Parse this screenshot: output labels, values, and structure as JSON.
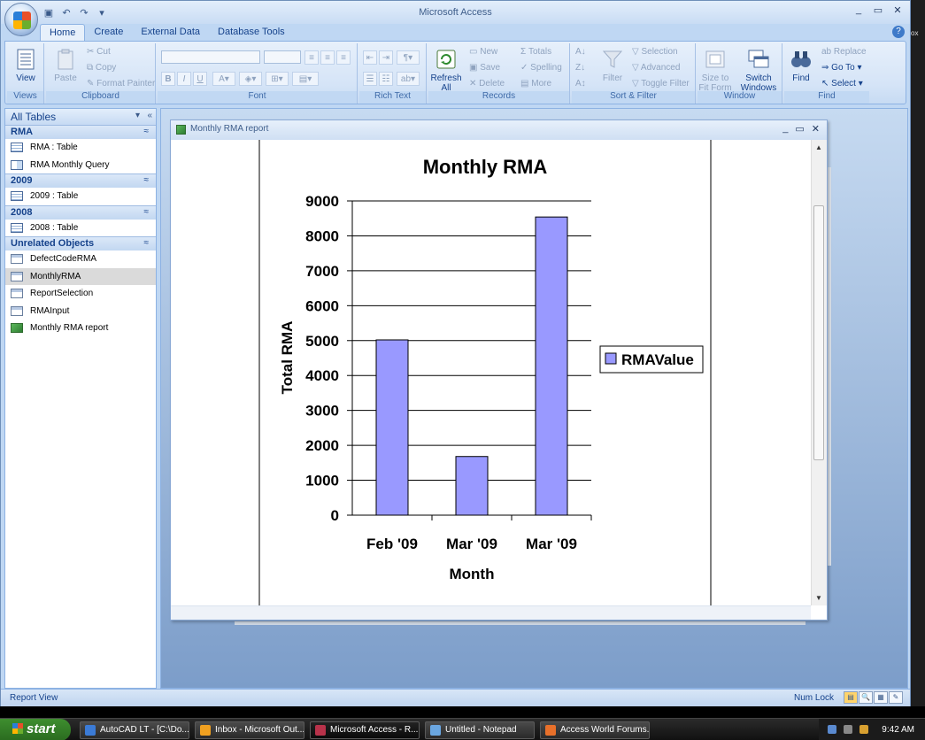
{
  "window": {
    "title": "Microsoft Access",
    "controls": [
      "_",
      "▭",
      "✕"
    ],
    "desktop_edge_text": "ox"
  },
  "quick_access": [
    "save",
    "undo",
    "redo",
    "customize"
  ],
  "tabs": [
    "Home",
    "Create",
    "External Data",
    "Database Tools"
  ],
  "ribbon": {
    "views": {
      "label": "Views",
      "view_btn": "View"
    },
    "clipboard": {
      "label": "Clipboard",
      "paste": "Paste",
      "cut": "Cut",
      "copy": "Copy",
      "format_painter": "Format Painter"
    },
    "font": {
      "label": "Font"
    },
    "rich_text": {
      "label": "Rich Text"
    },
    "records": {
      "label": "Records",
      "refresh": "Refresh All",
      "new": "New",
      "save": "Save",
      "delete": "Delete",
      "totals": "Totals",
      "spelling": "Spelling",
      "more": "More"
    },
    "sort_filter": {
      "label": "Sort & Filter",
      "filter": "Filter",
      "selection": "Selection",
      "advanced": "Advanced",
      "toggle_filter": "Toggle Filter"
    },
    "window": {
      "label": "Window",
      "size_to_fit": "Size to Fit Form",
      "switch_windows": "Switch Windows"
    },
    "find": {
      "label": "Find",
      "find": "Find",
      "replace": "Replace",
      "go_to": "Go To",
      "select": "Select"
    }
  },
  "nav": {
    "header": "All Tables",
    "sections": [
      {
        "title": "RMA",
        "items": [
          {
            "label": "RMA : Table",
            "icon": "table"
          },
          {
            "label": "RMA Monthly Query",
            "icon": "query"
          }
        ]
      },
      {
        "title": "2009",
        "items": [
          {
            "label": "2009 : Table",
            "icon": "table"
          }
        ]
      },
      {
        "title": "2008",
        "items": [
          {
            "label": "2008 : Table",
            "icon": "table"
          }
        ]
      },
      {
        "title": "Unrelated Objects",
        "items": [
          {
            "label": "DefectCodeRMA",
            "icon": "form"
          },
          {
            "label": "MonthlyRMA",
            "icon": "form",
            "selected": true
          },
          {
            "label": "ReportSelection",
            "icon": "form"
          },
          {
            "label": "RMAInput",
            "icon": "form"
          },
          {
            "label": "Monthly RMA report",
            "icon": "report"
          }
        ]
      }
    ]
  },
  "report_window": {
    "title": "Monthly RMA report",
    "controls": [
      "_",
      "▭",
      "✕"
    ]
  },
  "chart_data": {
    "type": "bar",
    "title": "Monthly RMA",
    "categories": [
      "Feb '09",
      "Mar '09",
      "Mar '09"
    ],
    "series": [
      {
        "name": "RMAValue",
        "values": [
          5020,
          1680,
          8540
        ],
        "color": "#9999ff"
      }
    ],
    "xlabel": "Month",
    "ylabel": "Total RMA",
    "ylim": [
      0,
      9000
    ],
    "yticks": [
      0,
      1000,
      2000,
      3000,
      4000,
      5000,
      6000,
      7000,
      8000,
      9000
    ],
    "grid": true,
    "legend": "right"
  },
  "status": {
    "left": "Report View",
    "right": "Num Lock"
  },
  "taskbar": {
    "start": "start",
    "tasks": [
      {
        "label": "AutoCAD LT - [C:\\Do...",
        "color": "#3b7bd6"
      },
      {
        "label": "Inbox - Microsoft Out...",
        "color": "#f0a020"
      },
      {
        "label": "Microsoft Access - R...",
        "color": "#b8324a",
        "active": true
      },
      {
        "label": "Untitled - Notepad",
        "color": "#6aa6e0"
      },
      {
        "label": "Access World Forums...",
        "color": "#e8702a"
      }
    ],
    "clock": "9:42 AM"
  }
}
